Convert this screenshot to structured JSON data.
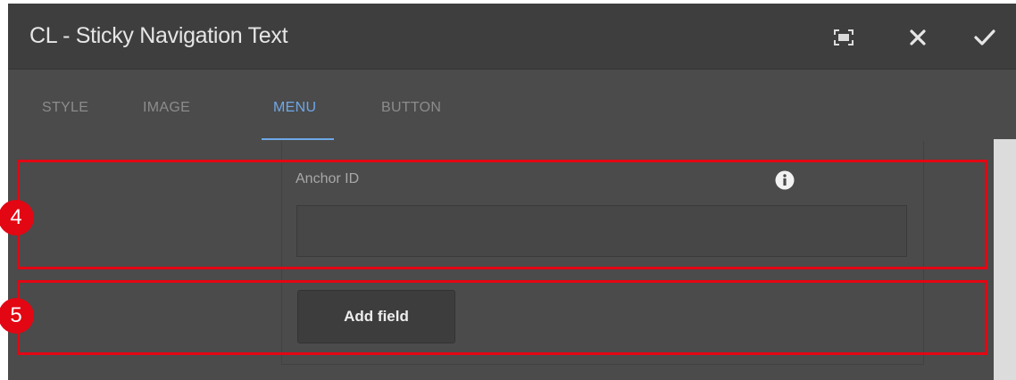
{
  "dialog": {
    "title": "CL - Sticky Navigation Text",
    "actions": [
      {
        "name": "fullscreen",
        "icon": "fullscreen-icon"
      },
      {
        "name": "cancel",
        "icon": "close-icon"
      },
      {
        "name": "done",
        "icon": "check-icon"
      }
    ]
  },
  "tabs": [
    {
      "label": "STYLE",
      "active": false
    },
    {
      "label": "IMAGE",
      "active": false
    },
    {
      "label": "MENU",
      "active": true
    },
    {
      "label": "BUTTON",
      "active": false
    }
  ],
  "form": {
    "anchor_label": "Anchor ID",
    "anchor_value": "",
    "info_icon": "info-icon",
    "add_field_label": "Add field"
  },
  "annotations": [
    {
      "number": "4"
    },
    {
      "number": "5"
    }
  ],
  "colors": {
    "accent": "#6ea7e8",
    "highlight": "#e30613",
    "dialog_bg": "#4b4b4b",
    "titlebar_bg": "#3e3e3e"
  }
}
